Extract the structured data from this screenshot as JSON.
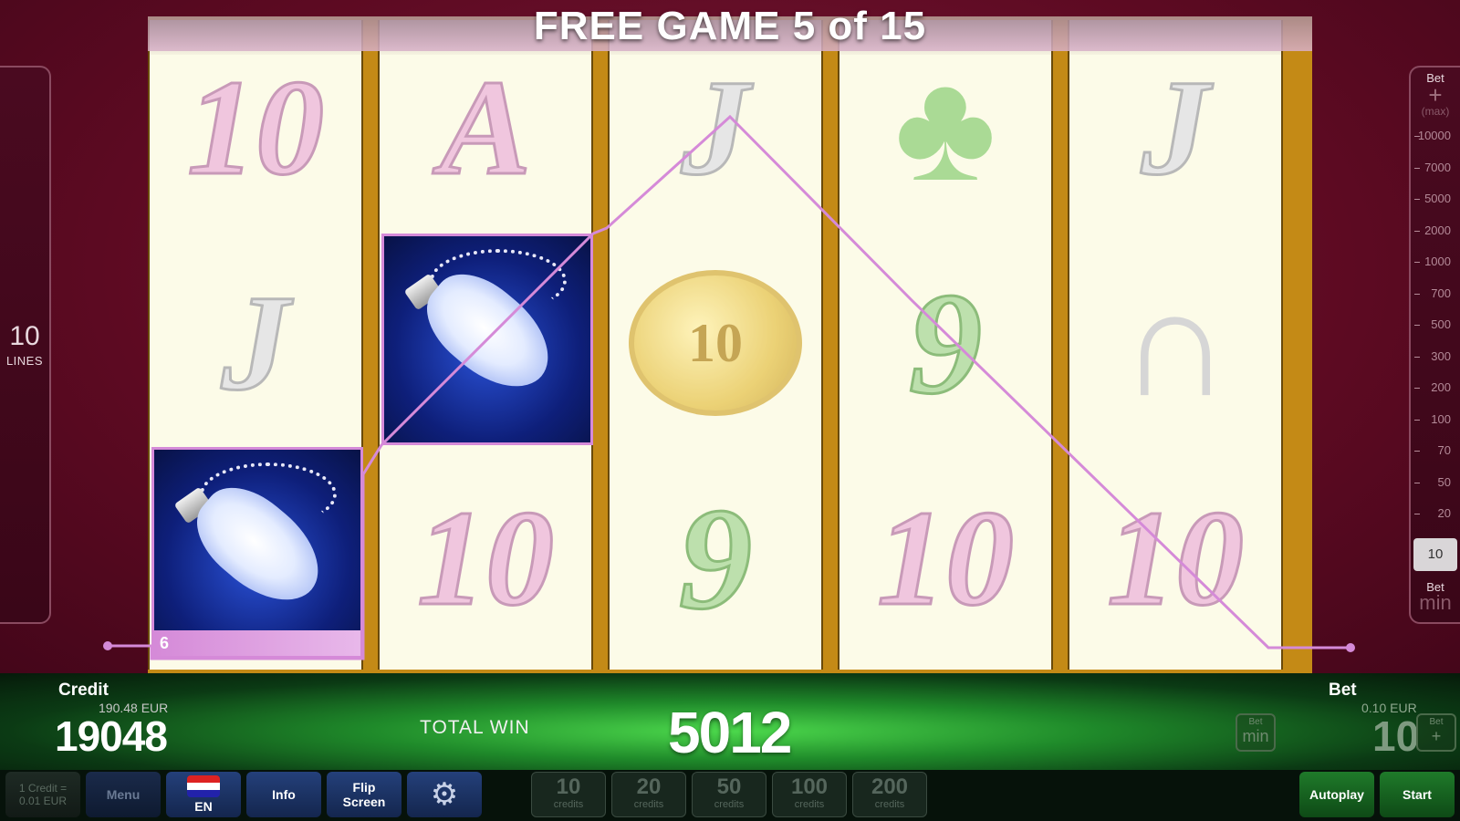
{
  "title": "FREE GAME 5 of 15",
  "lines": {
    "value": "10",
    "label": "LINES"
  },
  "bet_scale": {
    "header": "Bet",
    "plus": "+",
    "max": "(max)",
    "ticks": [
      "10000",
      "7000",
      "5000",
      "2000",
      "1000",
      "700",
      "500",
      "300",
      "200",
      "100",
      "70",
      "50",
      "20"
    ],
    "selected": "10",
    "min_header": "Bet",
    "min": "min"
  },
  "reels": [
    [
      "10",
      "J",
      "feather"
    ],
    [
      "A",
      "feather",
      "10"
    ],
    [
      "J",
      "coin",
      "9"
    ],
    [
      "clover",
      "9",
      "10"
    ],
    [
      "J",
      "horseshoe",
      "10"
    ]
  ],
  "coin_text": "10",
  "highlight_number": "6",
  "win_line_color": "#d58ad8",
  "credit": {
    "label": "Credit",
    "eur": "190.48 EUR",
    "value": "19048"
  },
  "total_win": {
    "label": "TOTAL WIN",
    "value": "5012"
  },
  "bet": {
    "label": "Bet",
    "eur": "0.10 EUR",
    "value": "10",
    "min_small": "Bet",
    "min_big": "min",
    "plus_small": "Bet",
    "plus_big": "+"
  },
  "toolbar": {
    "denom": "1 Credit =\n0.01 EUR",
    "menu": "Menu",
    "lang": "EN",
    "info": "Info",
    "flip_line1": "Flip",
    "flip_line2": "Screen",
    "credits": [
      {
        "value": "10",
        "unit": "credits"
      },
      {
        "value": "20",
        "unit": "credits"
      },
      {
        "value": "50",
        "unit": "credits"
      },
      {
        "value": "100",
        "unit": "credits"
      },
      {
        "value": "200",
        "unit": "credits"
      }
    ],
    "autoplay": "Autoplay",
    "start": "Start"
  }
}
